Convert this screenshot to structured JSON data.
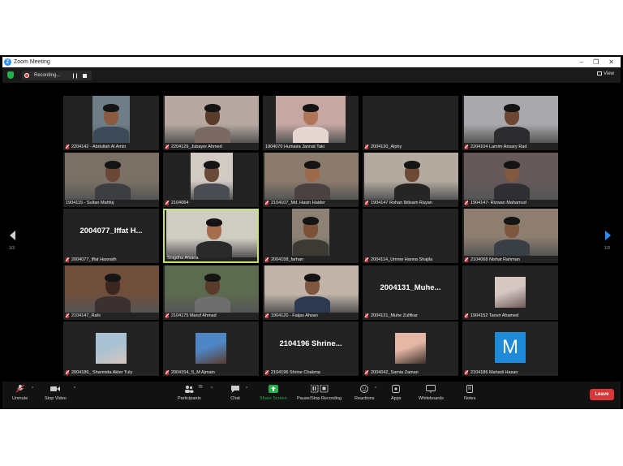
{
  "window": {
    "title": "Zoom Meeting"
  },
  "topbar": {
    "recording_label": "Recording...",
    "view_label": "View"
  },
  "pagination": {
    "left": "1/3",
    "right": "1/3"
  },
  "participants": [
    {
      "name": "2204142 - Abdullah Al Amin",
      "muted": true
    },
    {
      "name": "2204129_Jubayer Ahmed",
      "muted": true
    },
    {
      "name": "1904070 Humaira Jannat Taki",
      "muted": false
    },
    {
      "name": "2004130_Alphy",
      "muted": true
    },
    {
      "name": "2204104 Lamim Ansary Rad",
      "muted": true
    },
    {
      "name": "1904115 - Sultan Mahfuj",
      "muted": false
    },
    {
      "name": "2104064",
      "muted": true
    },
    {
      "name": "2104107_Md. Hasin Haider",
      "muted": true
    },
    {
      "name": "1904147 Rohan Ibtisam Rayan",
      "muted": true
    },
    {
      "name": "1904147- Rizwan Mahamud",
      "muted": true
    },
    {
      "name": "2004077_Iffat Hasnath",
      "muted": true,
      "display_name": "2004077_Iffat  H..."
    },
    {
      "name": "Snigdha Afsana",
      "muted": false
    },
    {
      "name": "2004158_farhan",
      "muted": true
    },
    {
      "name": "2004114_Umme Hanna Shajila",
      "muted": true
    },
    {
      "name": "2104068 Nishat Rahman",
      "muted": true
    },
    {
      "name": "2104147_Rahi",
      "muted": true
    },
    {
      "name": "2104175 Maruf Ahmad",
      "muted": true
    },
    {
      "name": "1904120 - Faijas Ahsan",
      "muted": true
    },
    {
      "name": "2004131_Muhe Zulfikar",
      "muted": true,
      "display_name": "2004131_Muhe..."
    },
    {
      "name": "1904152 Tanvir Ahamed",
      "muted": true
    },
    {
      "name": "2004186_ Sharmida Akter Tuly",
      "muted": true
    },
    {
      "name": "2004154_S_M Ajmain",
      "muted": true
    },
    {
      "name": "2104196 Shrine Chakma",
      "muted": true,
      "display_name": "2104196  Shrine..."
    },
    {
      "name": "2004042_Samia Zaman",
      "muted": true
    },
    {
      "name": "2104186 Mahadi Hasan",
      "muted": true,
      "avatar_letter": "M"
    }
  ],
  "toolbar": {
    "unmute": "Unmute",
    "stop_video": "Stop Video",
    "participants": "Participants",
    "participants_count": "70",
    "chat": "Chat",
    "share_screen": "Share Screen",
    "recording": "Pause/Stop Recording",
    "reactions": "Reactions",
    "apps": "Apps",
    "whiteboards": "Whiteboards",
    "notes": "Notes",
    "leave": "Leave"
  },
  "colors": {
    "active_speaker": "#c4e36a",
    "share_green": "#23b14d",
    "leave_red": "#d93737",
    "zoom_blue": "#2d8cff"
  }
}
